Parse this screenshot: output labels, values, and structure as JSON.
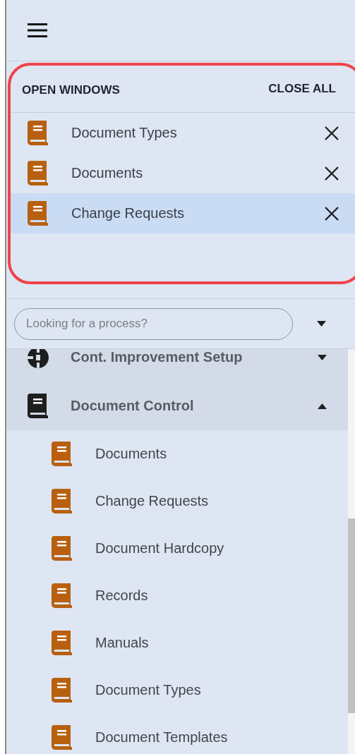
{
  "open_windows": {
    "title": "OPEN WINDOWS",
    "close_all": "CLOSE ALL",
    "items": [
      {
        "label": "Document Types",
        "selected": false
      },
      {
        "label": "Documents",
        "selected": false
      },
      {
        "label": "Change Requests",
        "selected": true
      }
    ]
  },
  "search": {
    "placeholder": "Looking for a process?"
  },
  "tree": [
    {
      "label": "Cont. Improvement Setup",
      "kind": "cycle",
      "expanded": false
    },
    {
      "label": "Document Control",
      "kind": "book",
      "expanded": true,
      "children": [
        {
          "label": "Documents",
          "kind": "book"
        },
        {
          "label": "Change Requests",
          "kind": "book"
        },
        {
          "label": "Document Hardcopy",
          "kind": "book"
        },
        {
          "label": "Records",
          "kind": "book"
        },
        {
          "label": "Manuals",
          "kind": "book"
        },
        {
          "label": "Document Types",
          "kind": "book"
        },
        {
          "label": "Document Templates",
          "kind": "book"
        }
      ]
    }
  ]
}
